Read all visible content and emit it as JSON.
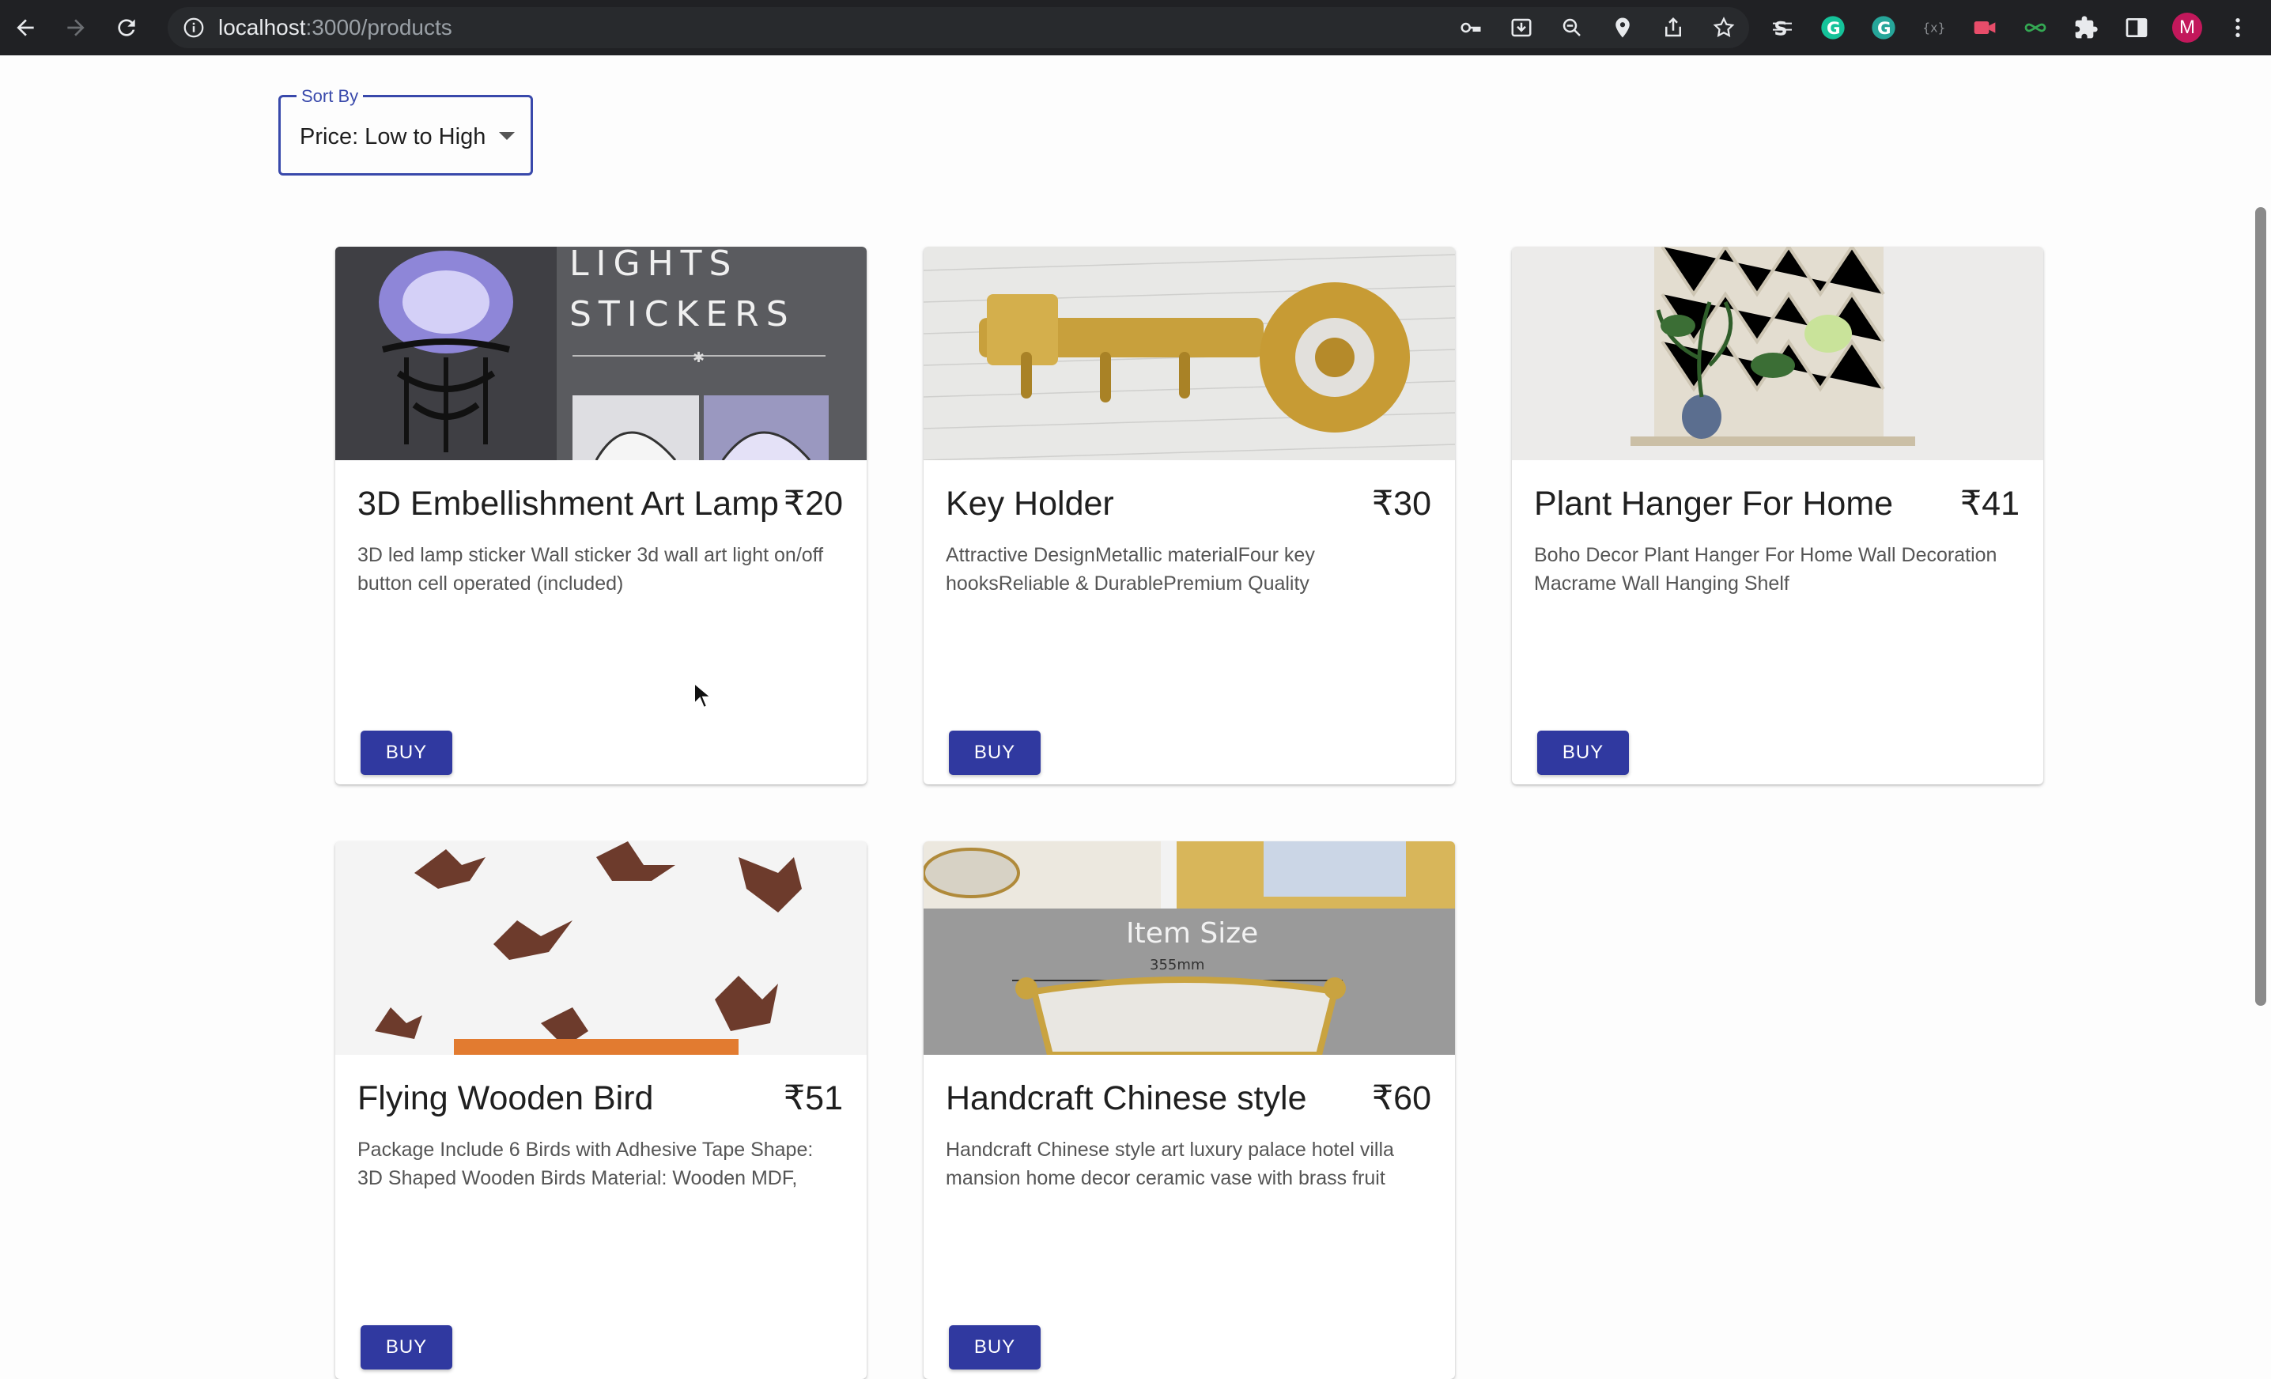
{
  "browser": {
    "url_host": "localhost",
    "url_path": ":3000/products",
    "profile_initial": "M"
  },
  "sort": {
    "label": "Sort By",
    "value": "Price: Low to High"
  },
  "products": [
    {
      "title": "3D Embellishment Art Lamp",
      "price": "₹20",
      "description": "3D led lamp sticker Wall sticker 3d wall art light on/off button cell operated (included)",
      "button": "BUY",
      "image_text_1": "LIGHTS",
      "image_text_2": "STICKERS"
    },
    {
      "title": "Key Holder",
      "price": "₹30",
      "description": "Attractive DesignMetallic materialFour key hooksReliable & DurablePremium Quality",
      "button": "BUY"
    },
    {
      "title": "Plant Hanger For Home",
      "price": "₹41",
      "description": "Boho Decor Plant Hanger For Home Wall Decoration Macrame Wall Hanging Shelf",
      "button": "BUY"
    },
    {
      "title": "Flying Wooden Bird",
      "price": "₹51",
      "description": "Package Include 6 Birds with Adhesive Tape Shape: 3D Shaped Wooden Birds Material: Wooden MDF,",
      "button": "BUY"
    },
    {
      "title": "Handcraft Chinese style",
      "price": "₹60",
      "description": "Handcraft Chinese style art luxury palace hotel villa mansion home decor ceramic vase with brass fruit",
      "button": "BUY",
      "image_text_1": "Item Size",
      "image_text_2": "355mm"
    }
  ]
}
